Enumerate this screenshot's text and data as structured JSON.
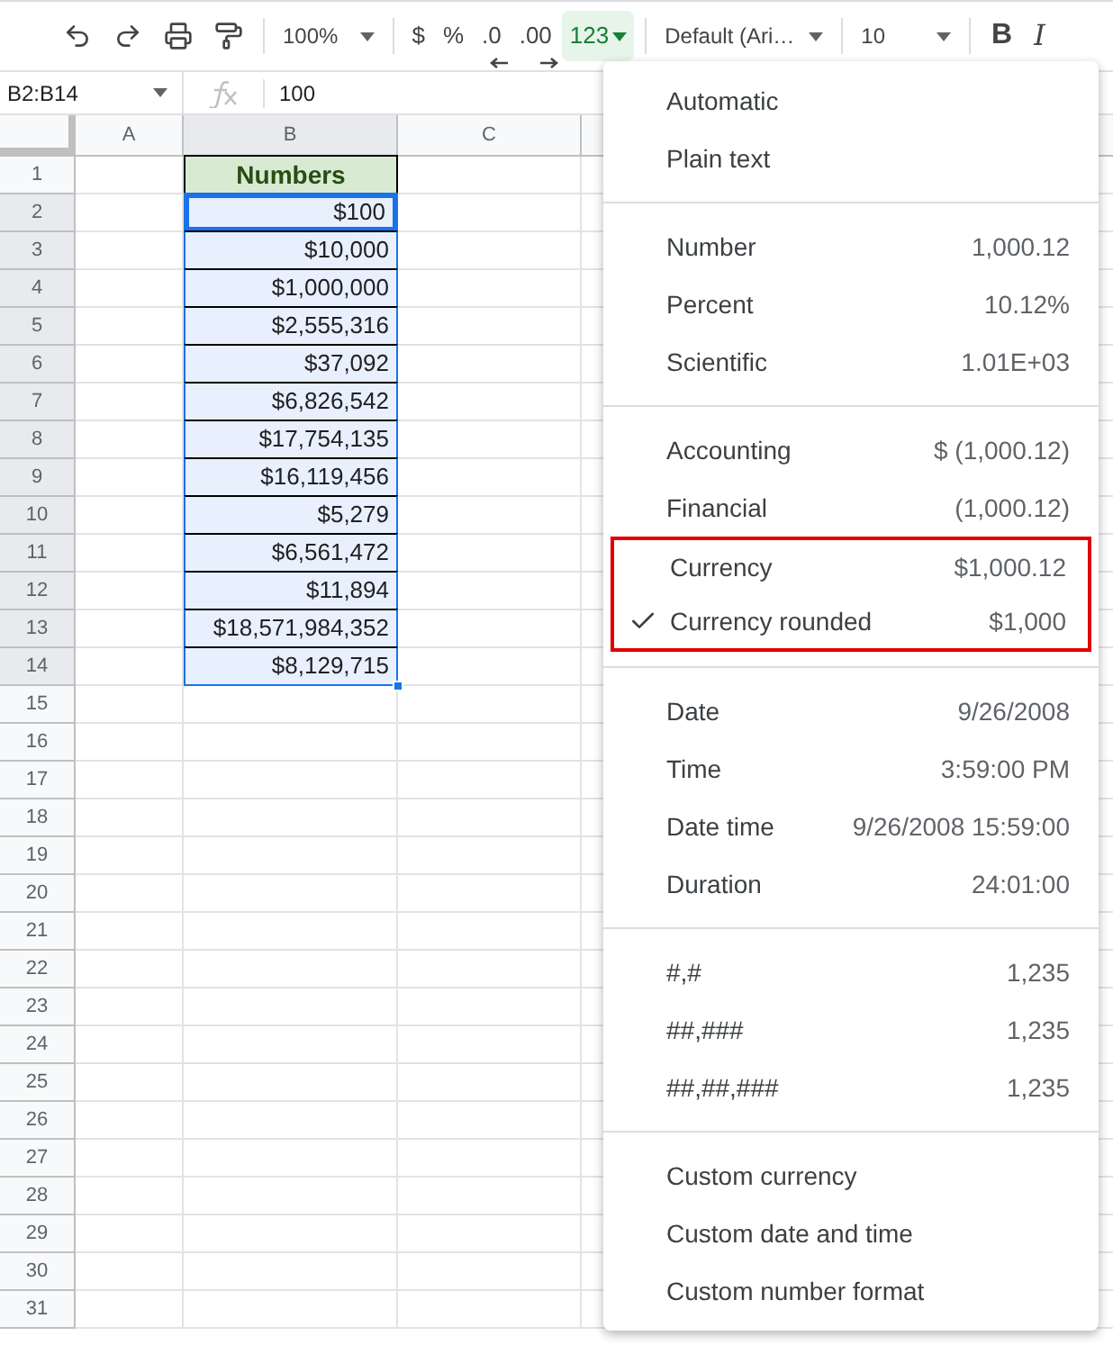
{
  "toolbar": {
    "zoom": "100%",
    "format_buttons": [
      {
        "label": "$",
        "kind": "plain",
        "active": false
      },
      {
        "label": "%",
        "kind": "plain",
        "active": false
      },
      {
        "label": ".0",
        "kind": "arrow_left",
        "active": false
      },
      {
        "label": ".00",
        "kind": "arrow_right",
        "active": false
      },
      {
        "label": "123",
        "kind": "dropdown",
        "active": true
      }
    ],
    "font": "Default (Ari…",
    "font_size": "10",
    "style_buttons": [
      {
        "label": "B",
        "kind": "bold"
      },
      {
        "label": "I",
        "kind": "italic"
      }
    ]
  },
  "formula_bar": {
    "name_box": "B2:B14",
    "value": "100"
  },
  "grid": {
    "columns": [
      {
        "label": "A",
        "selected": false
      },
      {
        "label": "B",
        "selected": true
      },
      {
        "label": "C",
        "selected": false
      }
    ],
    "rows": [
      {
        "number": "1",
        "selected": false,
        "cell_b": {
          "value": "Numbers",
          "kind": "header",
          "active": false
        }
      },
      {
        "number": "2",
        "selected": true,
        "cell_b": {
          "value": "$100",
          "kind": "value",
          "active": true
        }
      },
      {
        "number": "3",
        "selected": true,
        "cell_b": {
          "value": "$10,000",
          "kind": "value",
          "active": false
        }
      },
      {
        "number": "4",
        "selected": true,
        "cell_b": {
          "value": "$1,000,000",
          "kind": "value",
          "active": false
        }
      },
      {
        "number": "5",
        "selected": true,
        "cell_b": {
          "value": "$2,555,316",
          "kind": "value",
          "active": false
        }
      },
      {
        "number": "6",
        "selected": true,
        "cell_b": {
          "value": "$37,092",
          "kind": "value",
          "active": false
        }
      },
      {
        "number": "7",
        "selected": true,
        "cell_b": {
          "value": "$6,826,542",
          "kind": "value",
          "active": false
        }
      },
      {
        "number": "8",
        "selected": true,
        "cell_b": {
          "value": "$17,754,135",
          "kind": "value",
          "active": false
        }
      },
      {
        "number": "9",
        "selected": true,
        "cell_b": {
          "value": "$16,119,456",
          "kind": "value",
          "active": false
        }
      },
      {
        "number": "10",
        "selected": true,
        "cell_b": {
          "value": "$5,279",
          "kind": "value",
          "active": false
        }
      },
      {
        "number": "11",
        "selected": true,
        "cell_b": {
          "value": "$6,561,472",
          "kind": "value",
          "active": false
        }
      },
      {
        "number": "12",
        "selected": true,
        "cell_b": {
          "value": "$11,894",
          "kind": "value",
          "active": false
        }
      },
      {
        "number": "13",
        "selected": true,
        "cell_b": {
          "value": "$18,571,984,352",
          "kind": "value",
          "active": false
        }
      },
      {
        "number": "14",
        "selected": true,
        "cell_b": {
          "value": "$8,129,715",
          "kind": "value",
          "active": false
        }
      },
      {
        "number": "15",
        "selected": false
      },
      {
        "number": "16",
        "selected": false
      },
      {
        "number": "17",
        "selected": false
      },
      {
        "number": "18",
        "selected": false
      },
      {
        "number": "19",
        "selected": false
      },
      {
        "number": "20",
        "selected": false
      },
      {
        "number": "21",
        "selected": false
      },
      {
        "number": "22",
        "selected": false
      },
      {
        "number": "23",
        "selected": false
      },
      {
        "number": "24",
        "selected": false
      },
      {
        "number": "25",
        "selected": false
      },
      {
        "number": "26",
        "selected": false
      },
      {
        "number": "27",
        "selected": false
      },
      {
        "number": "28",
        "selected": false
      },
      {
        "number": "29",
        "selected": false
      },
      {
        "number": "30",
        "selected": false
      },
      {
        "number": "31",
        "selected": false
      }
    ]
  },
  "format_menu": {
    "sections": [
      [
        {
          "label": "Automatic",
          "checked": false,
          "outlined": false
        },
        {
          "label": "Plain text",
          "checked": false,
          "outlined": false
        }
      ],
      [
        {
          "label": "Number",
          "example": "1,000.12",
          "checked": false,
          "outlined": false
        },
        {
          "label": "Percent",
          "example": "10.12%",
          "checked": false,
          "outlined": false
        },
        {
          "label": "Scientific",
          "example": "1.01E+03",
          "checked": false,
          "outlined": false
        }
      ],
      [
        {
          "label": "Accounting",
          "example": "$ (1,000.12)",
          "checked": false,
          "outlined": false
        },
        {
          "label": "Financial",
          "example": "(1,000.12)",
          "checked": false,
          "outlined": false
        },
        {
          "label": "Currency",
          "example": "$1,000.12",
          "checked": false,
          "outlined": true
        },
        {
          "label": "Currency rounded",
          "example": "$1,000",
          "checked": true,
          "outlined": true
        }
      ],
      [
        {
          "label": "Date",
          "example": "9/26/2008",
          "checked": false,
          "outlined": false
        },
        {
          "label": "Time",
          "example": "3:59:00 PM",
          "checked": false,
          "outlined": false
        },
        {
          "label": "Date time",
          "example": "9/26/2008 15:59:00",
          "checked": false,
          "outlined": false
        },
        {
          "label": "Duration",
          "example": "24:01:00",
          "checked": false,
          "outlined": false
        }
      ],
      [
        {
          "label": "#,#",
          "example": "1,235",
          "checked": false,
          "outlined": false
        },
        {
          "label": "##,###",
          "example": "1,235",
          "checked": false,
          "outlined": false
        },
        {
          "label": "##,##,###",
          "example": "1,235",
          "checked": false,
          "outlined": false
        }
      ],
      [
        {
          "label": "Custom currency",
          "checked": false,
          "outlined": false
        },
        {
          "label": "Custom date and time",
          "checked": false,
          "outlined": false
        },
        {
          "label": "Custom number format",
          "checked": false,
          "outlined": false
        }
      ]
    ]
  }
}
